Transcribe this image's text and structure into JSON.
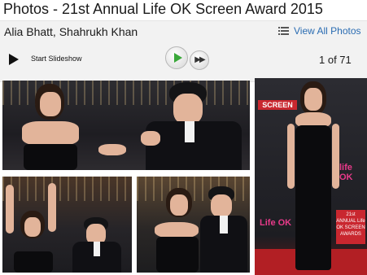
{
  "page": {
    "title": "Photos - 21st Annual Life OK Screen Award 2015"
  },
  "gallery": {
    "caption": "Alia Bhatt, Shahrukh Khan",
    "view_all_label": "View All Photos",
    "slideshow_label": "Start Slideshow",
    "counter": "1 of 71"
  },
  "logos": {
    "screen": "SCREEN",
    "life_ok_1": "Life OK",
    "life_ok_2": "life OK",
    "award": "21st ANNUAL Life OK SCREEN AWARDS"
  },
  "colors": {
    "link": "#2a6cb2",
    "play_green": "#3aa83a",
    "bar_bg": "#f2f2f2",
    "brand_red": "#c9272f"
  }
}
